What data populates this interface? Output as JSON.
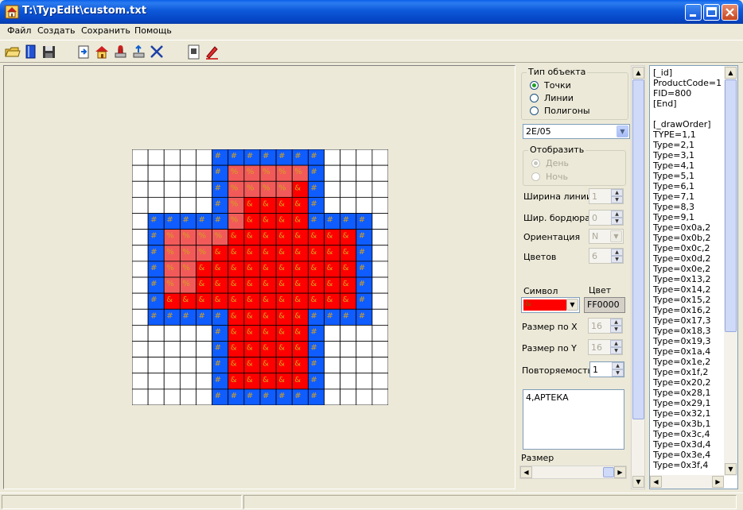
{
  "window": {
    "title": "T:\\TypEdit\\custom.txt"
  },
  "menu": [
    "Файл",
    "Создать",
    "Сохранить",
    "Помощь"
  ],
  "toolbar_icons": [
    "open-icon",
    "book-icon",
    "save-icon",
    "import-icon",
    "home-icon",
    "stamp-icon",
    "export-icon",
    "tools-icon",
    "preview-icon",
    "edit-icon"
  ],
  "panel": {
    "object_type_title": "Тип объекта",
    "object_types": [
      "Точки",
      "Линии",
      "Полигоны"
    ],
    "selected_object_type": 0,
    "type_code": "2E/05",
    "display_title": "Отобразить",
    "display_options": [
      "День",
      "Ночь"
    ],
    "line_width_label": "Ширина линии",
    "line_width_value": "1",
    "border_width_label": "Шир. бордюра",
    "border_width_value": "0",
    "orientation_label": "Ориентация",
    "orientation_value": "N",
    "colors_label": "Цветов",
    "colors_value": "6",
    "symbol_label": "Символ",
    "symbol_value": "&",
    "color_label": "Цвет",
    "color_value": "FF0000",
    "size_x_label": "Размер по X",
    "size_x_value": "16",
    "size_y_label": "Размер по Y",
    "size_y_value": "16",
    "repeat_label": "Повторяемость",
    "repeat_value": "1",
    "description": "4,АРТЕКА",
    "size_label": "Размер"
  },
  "colors": {
    "blue": "#0f5cff",
    "red": "#ff0000",
    "pink": "#f25a5a",
    "symbol": "#d4a020"
  },
  "pixel_grid": [
    "WWWWWBBBBBBBWWWW",
    "WWWWWBPPPPPBWWWW",
    "WWWWWBPPPPRBWWWW",
    "WWWWWBPRRRRBWWWW",
    "WBBBBBPRRRRBBBBW",
    "WBPPPPRRRRRRRRBW",
    "WBPPPRRRRRRRRRBW",
    "WBPPRRRRRRRRRRBW",
    "WBPPRRRRRRRRRRBW",
    "WBRRRRRRRRRRRRBW",
    "WBBBBBRRRRRBBBBW",
    "WWWWWBRRRRRBWWWW",
    "WWWWWBRRRRRBWWWW",
    "WWWWWBRRRRRBWWWW",
    "WWWWWBRRRRRBWWWW",
    "WWWWWBBBBBBBWWWW"
  ],
  "list_lines": [
    "[_id]",
    "ProductCode=1",
    "FID=800",
    "[End]",
    "",
    "[_drawOrder]",
    "TYPE=1,1",
    "Type=2,1",
    "Type=3,1",
    "Type=4,1",
    "Type=5,1",
    "Type=6,1",
    "Type=7,1",
    "Type=8,3",
    "Type=9,1",
    "Type=0x0a,2",
    "Type=0x0b,2",
    "Type=0x0c,2",
    "Type=0x0d,2",
    "Type=0x0e,2",
    "Type=0x13,2",
    "Type=0x14,2",
    "Type=0x15,2",
    "Type=0x16,2",
    "Type=0x17,3",
    "Type=0x18,3",
    "Type=0x19,3",
    "Type=0x1a,4",
    "Type=0x1e,2",
    "Type=0x1f,2",
    "Type=0x20,2",
    "Type=0x28,1",
    "Type=0x29,1",
    "Type=0x32,1",
    "Type=0x3b,1",
    "Type=0x3c,4",
    "Type=0x3d,4",
    "Type=0x3e,4",
    "Type=0x3f,4"
  ]
}
